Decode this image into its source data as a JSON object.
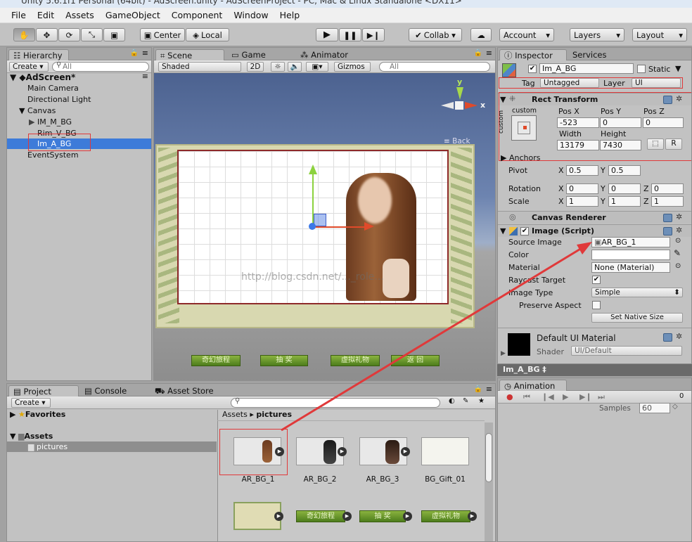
{
  "window_title": "Unity 5.6.1f1 Personal (64bit) - AdScreen.unity - AdScreenProject - PC, Mac & Linux Standalone <DX11>",
  "menu": [
    "File",
    "Edit",
    "Assets",
    "GameObject",
    "Component",
    "Window",
    "Help"
  ],
  "toolbar": {
    "center": "Center",
    "local": "Local",
    "collab": "Collab ▾",
    "account": "Account",
    "layers": "Layers",
    "layout": "Layout"
  },
  "hierarchy": {
    "tab": "Hierarchy",
    "create": "Create ▾",
    "search_placeholder": "All",
    "scene": "AdScreen*",
    "items": [
      "Main Camera",
      "Directional Light",
      "Canvas",
      "IM_M_BG",
      "Rim_V_BG",
      "Im_A_BG",
      "EventSystem"
    ]
  },
  "scene": {
    "tabs": [
      "Scene",
      "Game",
      "Animator"
    ],
    "shading": "Shaded",
    "mode2d": "2D",
    "gizmos": "Gizmos ▾",
    "search_placeholder": "All",
    "gizmo_axes": {
      "y": "y",
      "x": "x"
    },
    "back_label": "≡ Back",
    "watermark": "http://blog.csdn.net/..._role...",
    "buttons": [
      "奇幻旅程",
      "抽  奖",
      "虚拟礼物",
      "返  回"
    ]
  },
  "inspector": {
    "tabs": [
      "Inspector",
      "Services"
    ],
    "object_name": "Im_A_BG",
    "static": "Static",
    "tag_label": "Tag",
    "tag_value": "Untagged",
    "layer_label": "Layer",
    "layer_value": "UI",
    "rect": {
      "title": "Rect Transform",
      "anchor_label": "custom",
      "side_label": "custom",
      "pos_x_label": "Pos X",
      "pos_y_label": "Pos Y",
      "pos_z_label": "Pos Z",
      "pos_x": "-523",
      "pos_y": "0",
      "pos_z": "0",
      "width_label": "Width",
      "height_label": "Height",
      "width": "13179",
      "height": "7430",
      "r_button": "R",
      "anchors": "Anchors",
      "pivot": "Pivot",
      "pivot_x": "0.5",
      "pivot_y": "0.5",
      "rotation": "Rotation",
      "rot_x": "0",
      "rot_y": "0",
      "rot_z": "0",
      "scale": "Scale",
      "scale_x": "1",
      "scale_y": "1",
      "scale_z": "1",
      "x": "X",
      "y": "Y",
      "z": "Z"
    },
    "canvas_renderer": "Canvas Renderer",
    "image": {
      "title": "Image (Script)",
      "source_label": "Source Image",
      "source_value": "AR_BG_1",
      "color_label": "Color",
      "material_label": "Material",
      "material_value": "None (Material)",
      "raycast_label": "Raycast Target",
      "type_label": "Image Type",
      "type_value": "Simple",
      "preserve_label": "Preserve Aspect",
      "native_button": "Set Native Size"
    },
    "material": {
      "name": "Default UI Material",
      "shader_label": "Shader",
      "shader_value": "UI/Default"
    },
    "footer_label": "Im_A_BG ‡"
  },
  "animation": {
    "tab": "Animation",
    "samples_label": "Samples",
    "samples_value": "60",
    "frame": "0"
  },
  "project": {
    "tabs": [
      "Project",
      "Console",
      "Asset Store"
    ],
    "create": "Create ▾",
    "favorites": "Favorites",
    "assets": "Assets",
    "pictures": "pictures",
    "breadcrumb_root": "Assets",
    "breadcrumb_child": "pictures",
    "thumbnails": [
      "AR_BG_1",
      "AR_BG_2",
      "AR_BG_3",
      "BG_Gift_01"
    ],
    "thumbnails_row2_text": [
      "奇幻旅程",
      "抽  奖",
      "虚拟礼物"
    ]
  },
  "colors": {
    "selection": "#3d7bd9",
    "highlight_box": "#e0393a",
    "green_button": "#5b8c24"
  }
}
